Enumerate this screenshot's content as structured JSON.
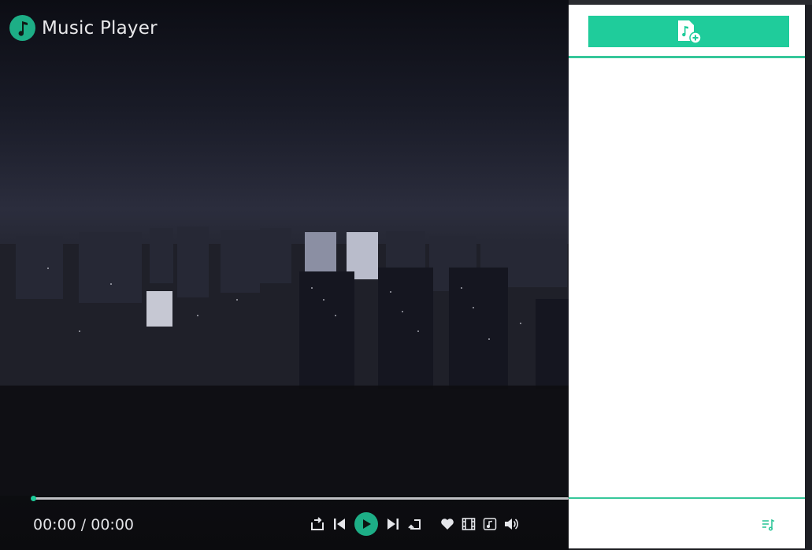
{
  "app": {
    "title": "Music Player",
    "accent": "#1dae86"
  },
  "playback": {
    "time_display": "00:00 / 00:00",
    "progress": 0
  },
  "controls": {
    "icons": [
      "repeat-icon",
      "previous-icon",
      "play-icon",
      "next-icon",
      "shuffle-icon"
    ],
    "extras": [
      "heart-icon",
      "video-icon",
      "lyrics-icon",
      "volume-icon"
    ]
  },
  "sidebar": {
    "add_button_icon": "add-file-icon",
    "playlist_icon": "playlist-icon",
    "items": []
  }
}
